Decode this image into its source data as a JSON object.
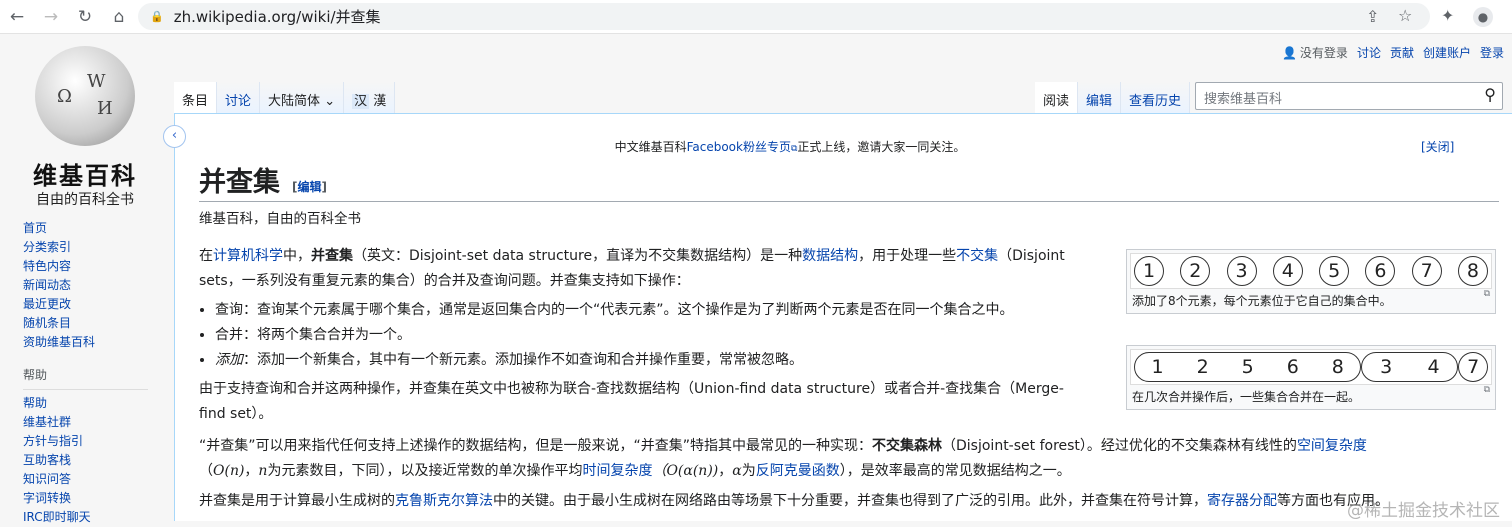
{
  "browser": {
    "url": "zh.wikipedia.org/wiki/并查集"
  },
  "logo": {
    "wordmark": "维基百科",
    "tagline": "自由的百科全书"
  },
  "sidebar": {
    "nav": [
      "首页",
      "分类索引",
      "特色内容",
      "新闻动态",
      "最近更改",
      "随机条目",
      "资助维基百科"
    ],
    "help_heading": "帮助",
    "help": [
      "帮助",
      "维基社群",
      "方针与指引",
      "互助客栈",
      "知识问答",
      "字词转换",
      "IRC即时聊天"
    ]
  },
  "personal": {
    "not_logged": "没有登录",
    "talk": "讨论",
    "contrib": "贡献",
    "create": "创建账户",
    "login": "登录"
  },
  "tabs": {
    "article": "条目",
    "talk": "讨论",
    "variant": "大陆简体",
    "han1": "汉",
    "han2": "漢",
    "read": "阅读",
    "edit": "编辑",
    "history": "查看历史"
  },
  "search": {
    "placeholder": "搜索维基百科"
  },
  "notice": {
    "pre": "中文维基百科",
    "link": "Facebook粉丝专页",
    "post": "正式上线，邀请大家一同关注。",
    "close": "[关闭]"
  },
  "title": "并查集",
  "title_edit": "编辑",
  "sitesub": "维基百科，自由的百科全书",
  "p1": {
    "a": "在",
    "l1": "计算机科学",
    "b": "中，",
    "bold": "并查集",
    "c": "（英文：Disjoint-set data structure，直译为不交集数据结构）是一种",
    "l2": "数据结构",
    "d": "，用于处理一些",
    "l3": "不交集",
    "e": "（Disjoint sets，一系列没有重复元素的集合）的合并及查询问题。并查集支持如下操作："
  },
  "bullets": [
    {
      "term": "查询",
      "text": "：查询某个元素属于哪个集合，通常是返回集合内的一个“代表元素”。这个操作是为了判断两个元素是否在同一个集合之中。"
    },
    {
      "term": "合并",
      "text": "：将两个集合合并为一个。"
    },
    {
      "term": "添加",
      "text": "：添加一个新集合，其中有一个新元素。添加操作不如查询和合并操作重要，常常被忽略。"
    }
  ],
  "p2": "由于支持查询和合并这两种操作，并查集在英文中也被称为联合-查找数据结构（Union-find data structure）或者合并-查找集合（Merge-find set）。",
  "p3": {
    "a": "“并查集”可以用来指代任何支持上述操作的数据结构，但是一般来说，“并查集”特指其中最常见的一种实现：",
    "bold": "不交集森林",
    "b": "（Disjoint-set forest）。经过优化的不交集森林有线性的",
    "l1": "空间复杂度",
    "m1": "O(n)",
    "c": "，",
    "m2": "n",
    "d": "为元素数目，下同），以及接近常数的单次操作平均",
    "l2": "时间复杂度",
    "m3": "（O(α(n))",
    "e": "，",
    "m4": "α",
    "f": "为",
    "l3": "反阿克曼函数",
    "g": "），是效率最高的常见数据结构之一。"
  },
  "p4": {
    "a": "并查集是用于计算最小生成树的",
    "l1": "克鲁斯克尔算法",
    "b": "中的关键。由于最小生成树在网络路由等场景下十分重要，并查集也得到了广泛的引用。此外，并查集在符号计算，",
    "l2": "寄存器分配",
    "c": "等方面也有应用。"
  },
  "fig1": {
    "nodes": [
      "1",
      "2",
      "3",
      "4",
      "5",
      "6",
      "7",
      "8"
    ],
    "caption": "添加了8个元素，每个元素位于它自己的集合中。"
  },
  "fig2": {
    "groups": [
      [
        "1",
        "2",
        "5",
        "6",
        "8"
      ],
      [
        "3",
        "4"
      ],
      [
        "7"
      ]
    ],
    "caption": "在几次合并操作后，一些集合合并在一起。"
  },
  "watermark": "@稀土掘金技术社区"
}
